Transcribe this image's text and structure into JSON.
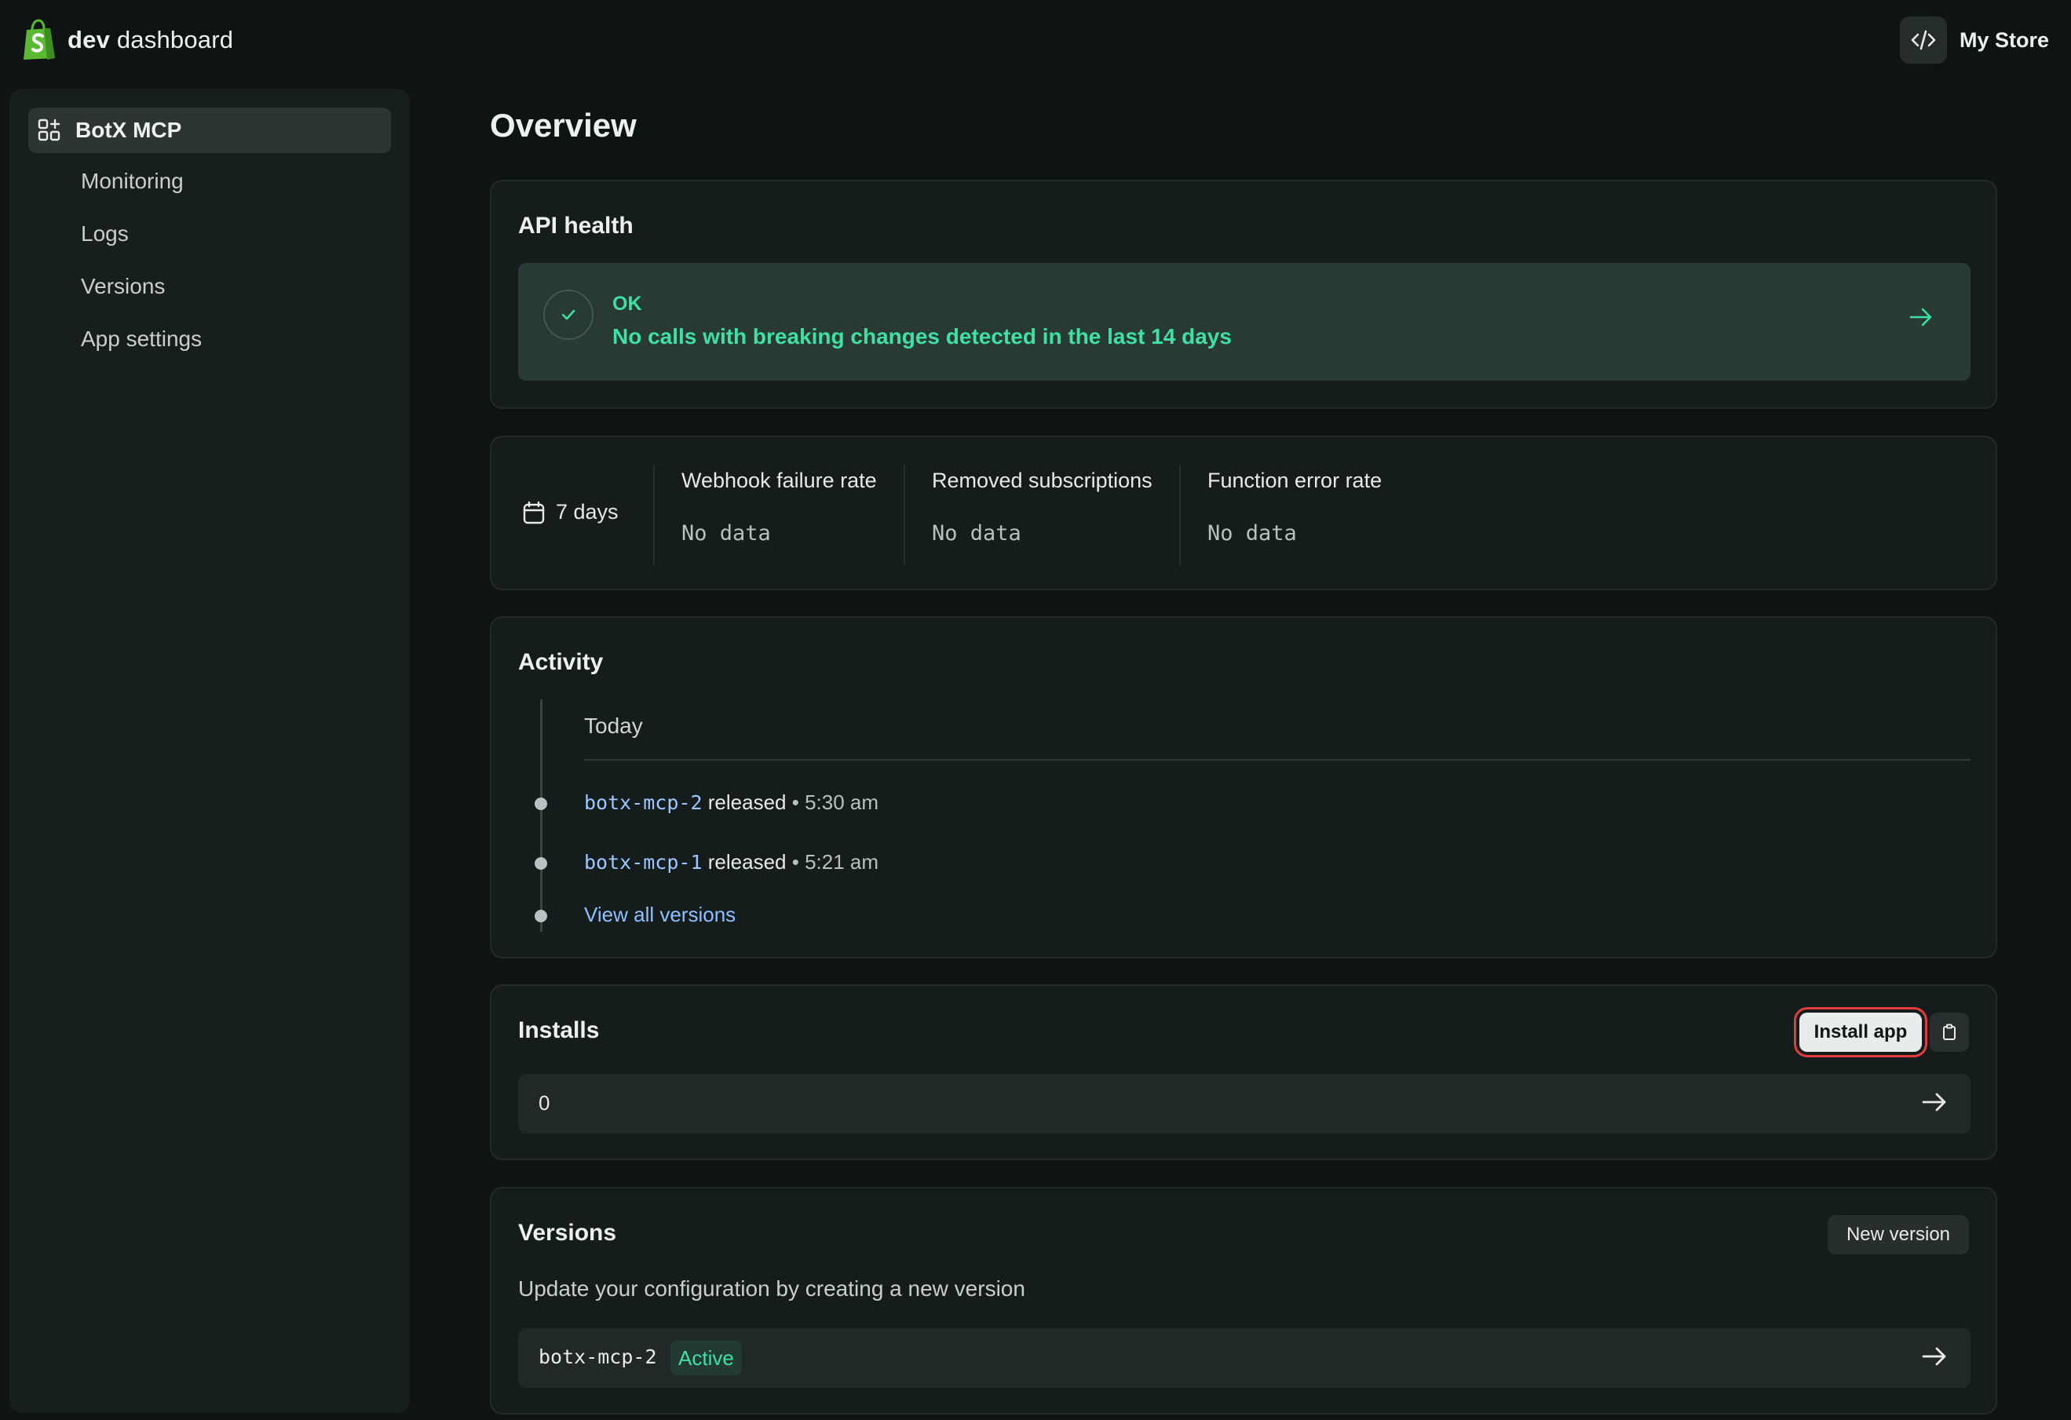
{
  "header": {
    "brand_bold": "dev",
    "brand_rest": "dashboard",
    "store_name": "My Store"
  },
  "sidebar": {
    "app_name": "BotX MCP",
    "items": [
      {
        "label": "Monitoring"
      },
      {
        "label": "Logs"
      },
      {
        "label": "Versions"
      },
      {
        "label": "App settings"
      }
    ]
  },
  "page": {
    "title": "Overview"
  },
  "api_health": {
    "title": "API health",
    "status": "OK",
    "message": "No calls with breaking changes detected in the last 14 days"
  },
  "metrics": {
    "period": "7 days",
    "items": [
      {
        "label": "Webhook failure rate",
        "value": "No data"
      },
      {
        "label": "Removed subscriptions",
        "value": "No data"
      },
      {
        "label": "Function error rate",
        "value": "No data"
      }
    ]
  },
  "activity": {
    "title": "Activity",
    "day": "Today",
    "events": [
      {
        "version": "botx-mcp-2",
        "action": "released",
        "time": "5:30 am"
      },
      {
        "version": "botx-mcp-1",
        "action": "released",
        "time": "5:21 am"
      }
    ],
    "view_all": "View all versions"
  },
  "installs": {
    "title": "Installs",
    "install_button": "Install app",
    "count": "0"
  },
  "versions": {
    "title": "Versions",
    "new_button": "New version",
    "subtitle": "Update your configuration by creating a new version",
    "current": {
      "name": "botx-mcp-2",
      "status": "Active"
    }
  },
  "colors": {
    "background": "#0e1414",
    "card": "#151c1c",
    "success": "#3ee0a3",
    "link": "#8ec0ff",
    "brand_green": "#5bb833",
    "highlight_border": "#e23b3b"
  },
  "icons": [
    "shopify-bag-icon",
    "code-icon",
    "apps-grid-icon",
    "check-icon",
    "arrow-right-icon",
    "calendar-icon",
    "clipboard-icon"
  ]
}
